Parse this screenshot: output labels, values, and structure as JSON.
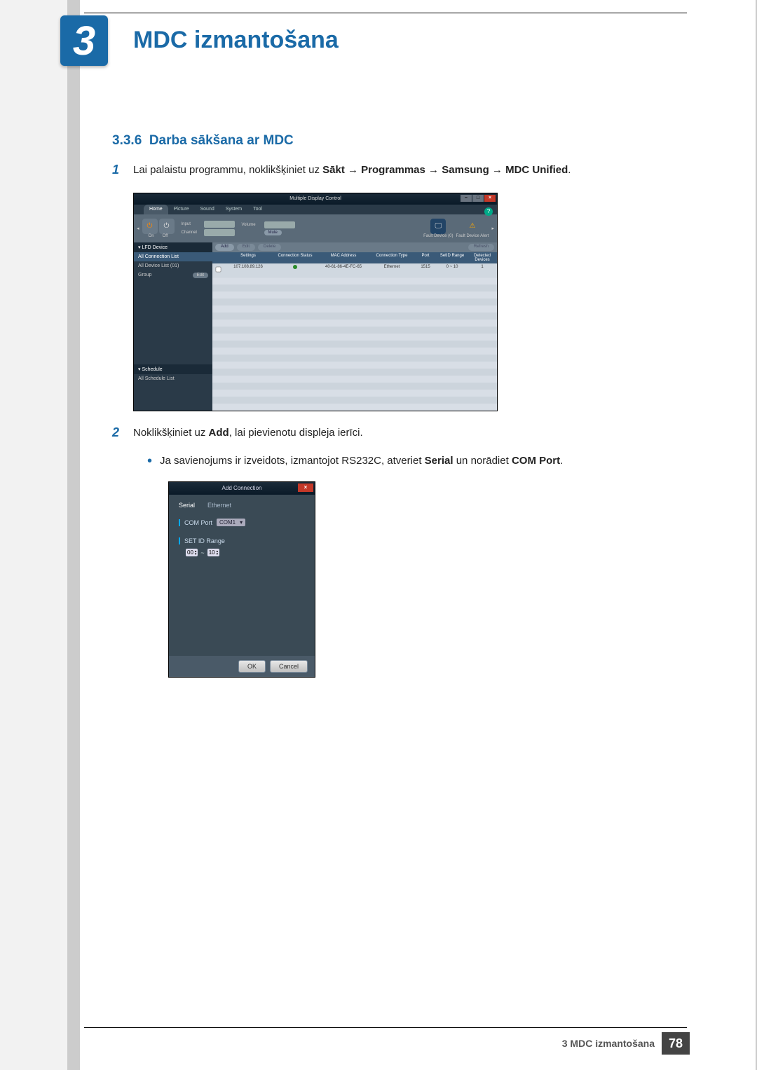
{
  "chapter": {
    "number": "3",
    "title": "MDC izmantošana"
  },
  "section": {
    "number": "3.3.6",
    "title": "Darba sākšana ar MDC"
  },
  "steps": {
    "s1": {
      "num": "1",
      "pre": "Lai palaistu programmu, noklikšķiniet uz ",
      "path1": "Sākt",
      "arrow": " → ",
      "path2": "Programmas",
      "path3": "Samsung",
      "path4": "MDC Unified",
      "post": "."
    },
    "s2": {
      "num": "2",
      "pre": "Noklikšķiniet uz ",
      "bold": "Add",
      "post": ", lai pievienotu displeja ierīci."
    },
    "bullet": {
      "pre": "Ja savienojums ir izveidots, izmantojot RS232C, atveriet ",
      "b1": "Serial",
      "mid": " un norādiet ",
      "b2": "COM Port",
      "post": "."
    }
  },
  "mdc": {
    "title": "Multiple Display Control",
    "menu": {
      "home": "Home",
      "picture": "Picture",
      "sound": "Sound",
      "system": "System",
      "tool": "Tool"
    },
    "toolbar": {
      "on": "On",
      "off": "Off",
      "input": "Input",
      "channel": "Channel",
      "volume": "Volume",
      "mute": "Mute",
      "fault0": "Fault Device (0)",
      "alert": "Fault Device Alert"
    },
    "side": {
      "lfd": "LFD Device",
      "allconn": "All Connection List",
      "alldev": "All Device List (01)",
      "group": "Group",
      "edit": "Edit",
      "sched": "Schedule",
      "allsched": "All Schedule List"
    },
    "actions": {
      "add": "Add",
      "edit": "Edit",
      "delete": "Delete",
      "refresh": "Refresh"
    },
    "thead": {
      "settings": "Settings",
      "cs": "Connection Status",
      "mac": "MAC Address",
      "ct": "Connection Type",
      "port": "Port",
      "sid": "SetID Range",
      "dd": "Detected Devices"
    },
    "row": {
      "settings": "107.108.89.126",
      "mac": "40-61-86-4E-FC-65",
      "ct": "Ethernet",
      "port": "1515",
      "sid": "0 ~ 10",
      "dd": "1"
    }
  },
  "dialog": {
    "title": "Add Connection",
    "tabs": {
      "serial": "Serial",
      "ethernet": "Ethernet"
    },
    "comport": {
      "label": "COM Port",
      "value": "COM1"
    },
    "setid": {
      "label": "SET ID Range",
      "from": "00",
      "sep": "~",
      "to": "10"
    },
    "buttons": {
      "ok": "OK",
      "cancel": "Cancel"
    }
  },
  "footer": {
    "text": "3 MDC izmantošana",
    "page": "78"
  }
}
